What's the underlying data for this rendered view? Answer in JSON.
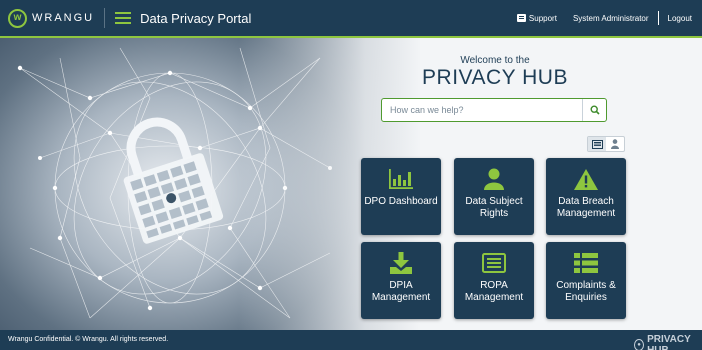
{
  "header": {
    "logo_text": "WRANGU",
    "portal_title": "Data Privacy Portal",
    "support_label": "Support",
    "user_label": "System Administrator",
    "logout_label": "Logout"
  },
  "hero": {
    "welcome_text": "Welcome to the",
    "hub_title": "PRIVACY HUB",
    "search_placeholder": "How can we help?"
  },
  "view_toggle": {
    "options": [
      "grid-view-icon",
      "user-view-icon"
    ],
    "selected": "grid-view-icon"
  },
  "tiles": [
    {
      "label": "DPO Dashboard",
      "icon": "bar-chart-icon"
    },
    {
      "label": "Data Subject Rights",
      "icon": "person-icon"
    },
    {
      "label": "Data Breach Management",
      "icon": "warning-icon"
    },
    {
      "label": "DPIA Management",
      "icon": "download-icon"
    },
    {
      "label": "ROPA Management",
      "icon": "document-list-icon"
    },
    {
      "label": "Complaints & Enquiries",
      "icon": "list-icon"
    }
  ],
  "footer": {
    "copyright": "Wrangu Confidential. © Wrangu. All rights reserved.",
    "logo_text": "PRIVACY HUB"
  },
  "colors": {
    "primary": "#1e3d55",
    "accent": "#8ec63f"
  }
}
